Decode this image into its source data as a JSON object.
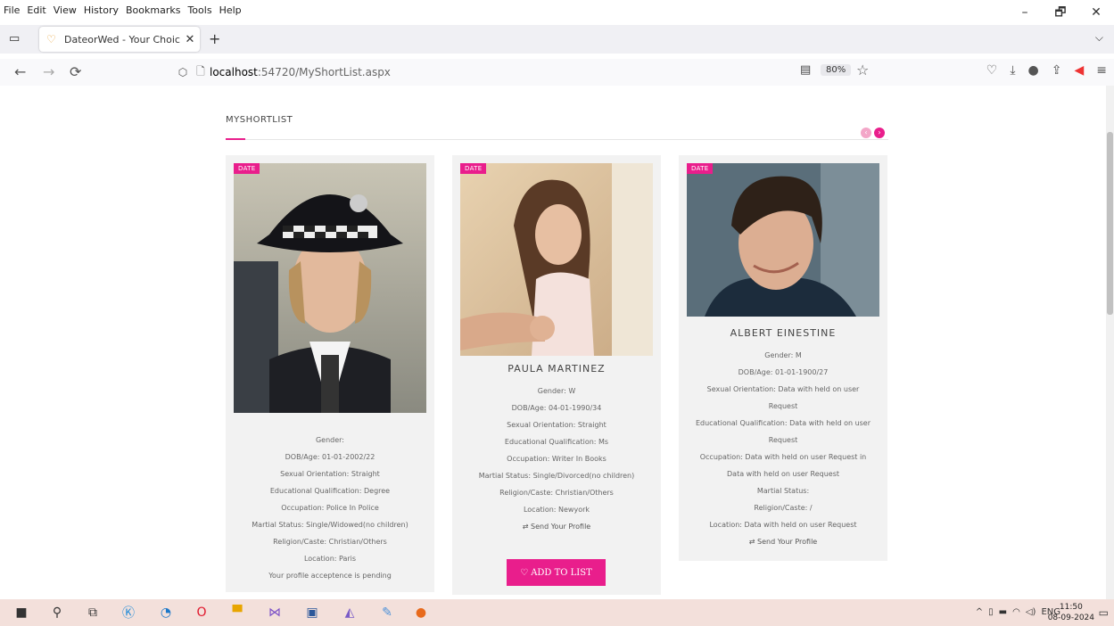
{
  "menu": [
    "File",
    "Edit",
    "View",
    "History",
    "Bookmarks",
    "Tools",
    "Help"
  ],
  "window_controls": [
    "–",
    "🗗",
    "✕"
  ],
  "tab": {
    "title": "DateorWed - Your Choice",
    "close": "✕",
    "new_tab": "+",
    "list_all": "⌵"
  },
  "nav": {
    "back": "←",
    "forward": "→",
    "reload": "⟳",
    "url_host": "localhost",
    "url_path": ":54720/MyShortList.aspx",
    "zoom": "80%",
    "star": "☆"
  },
  "page": {
    "section_title": "MYSHORTLIST",
    "arrows": {
      "prev": "‹",
      "next": "›"
    },
    "cards": [
      {
        "tag": "DATE",
        "lines": [
          "Gender:",
          "DOB/Age: 01-01-2002/22",
          "Sexual Orientation: Straight",
          "Educational Qualification: Degree",
          "Occupation: Police In Police",
          "Martial Status: Single/Widowed(no children)",
          "Religion/Caste: Christian/Others",
          "Location: Paris",
          "Your profile acceptence is pending"
        ]
      },
      {
        "tag": "DATE",
        "name": "PAULA MARTINEZ",
        "lines": [
          "Gender: W",
          "DOB/Age: 04-01-1990/34",
          "Sexual Orientation: Straight",
          "Educational Qualification: Ms",
          "Occupation: Writer In Books",
          "Martial Status: Single/Divorced(no children)",
          "Religion/Caste: Christian/Others",
          "Location: Newyork"
        ],
        "send": "⇄ Send Your Profile",
        "add_button": "ADD TO LIST"
      },
      {
        "tag": "DATE",
        "name": "ALBERT EINESTINE",
        "lines": [
          "Gender: M",
          "DOB/Age: 01-01-1900/27",
          "Sexual Orientation: Data with held on user",
          "Request",
          "Educational Qualification: Data with held on user",
          "Request",
          "Occupation: Data with held on user Request in",
          "Data with held on user Request",
          "Martial Status:",
          "Religion/Caste: /",
          "Location: Data with held on user Request"
        ],
        "send": "⇄ Send Your Profile"
      }
    ]
  },
  "taskbar": {
    "tray_lang": "ENG",
    "time": "11:50",
    "date": "08-09-2024"
  },
  "colors": {
    "accent": "#e91e8c",
    "card_bg": "#f2f2f2",
    "taskbar_bg": "#f3e0db"
  }
}
